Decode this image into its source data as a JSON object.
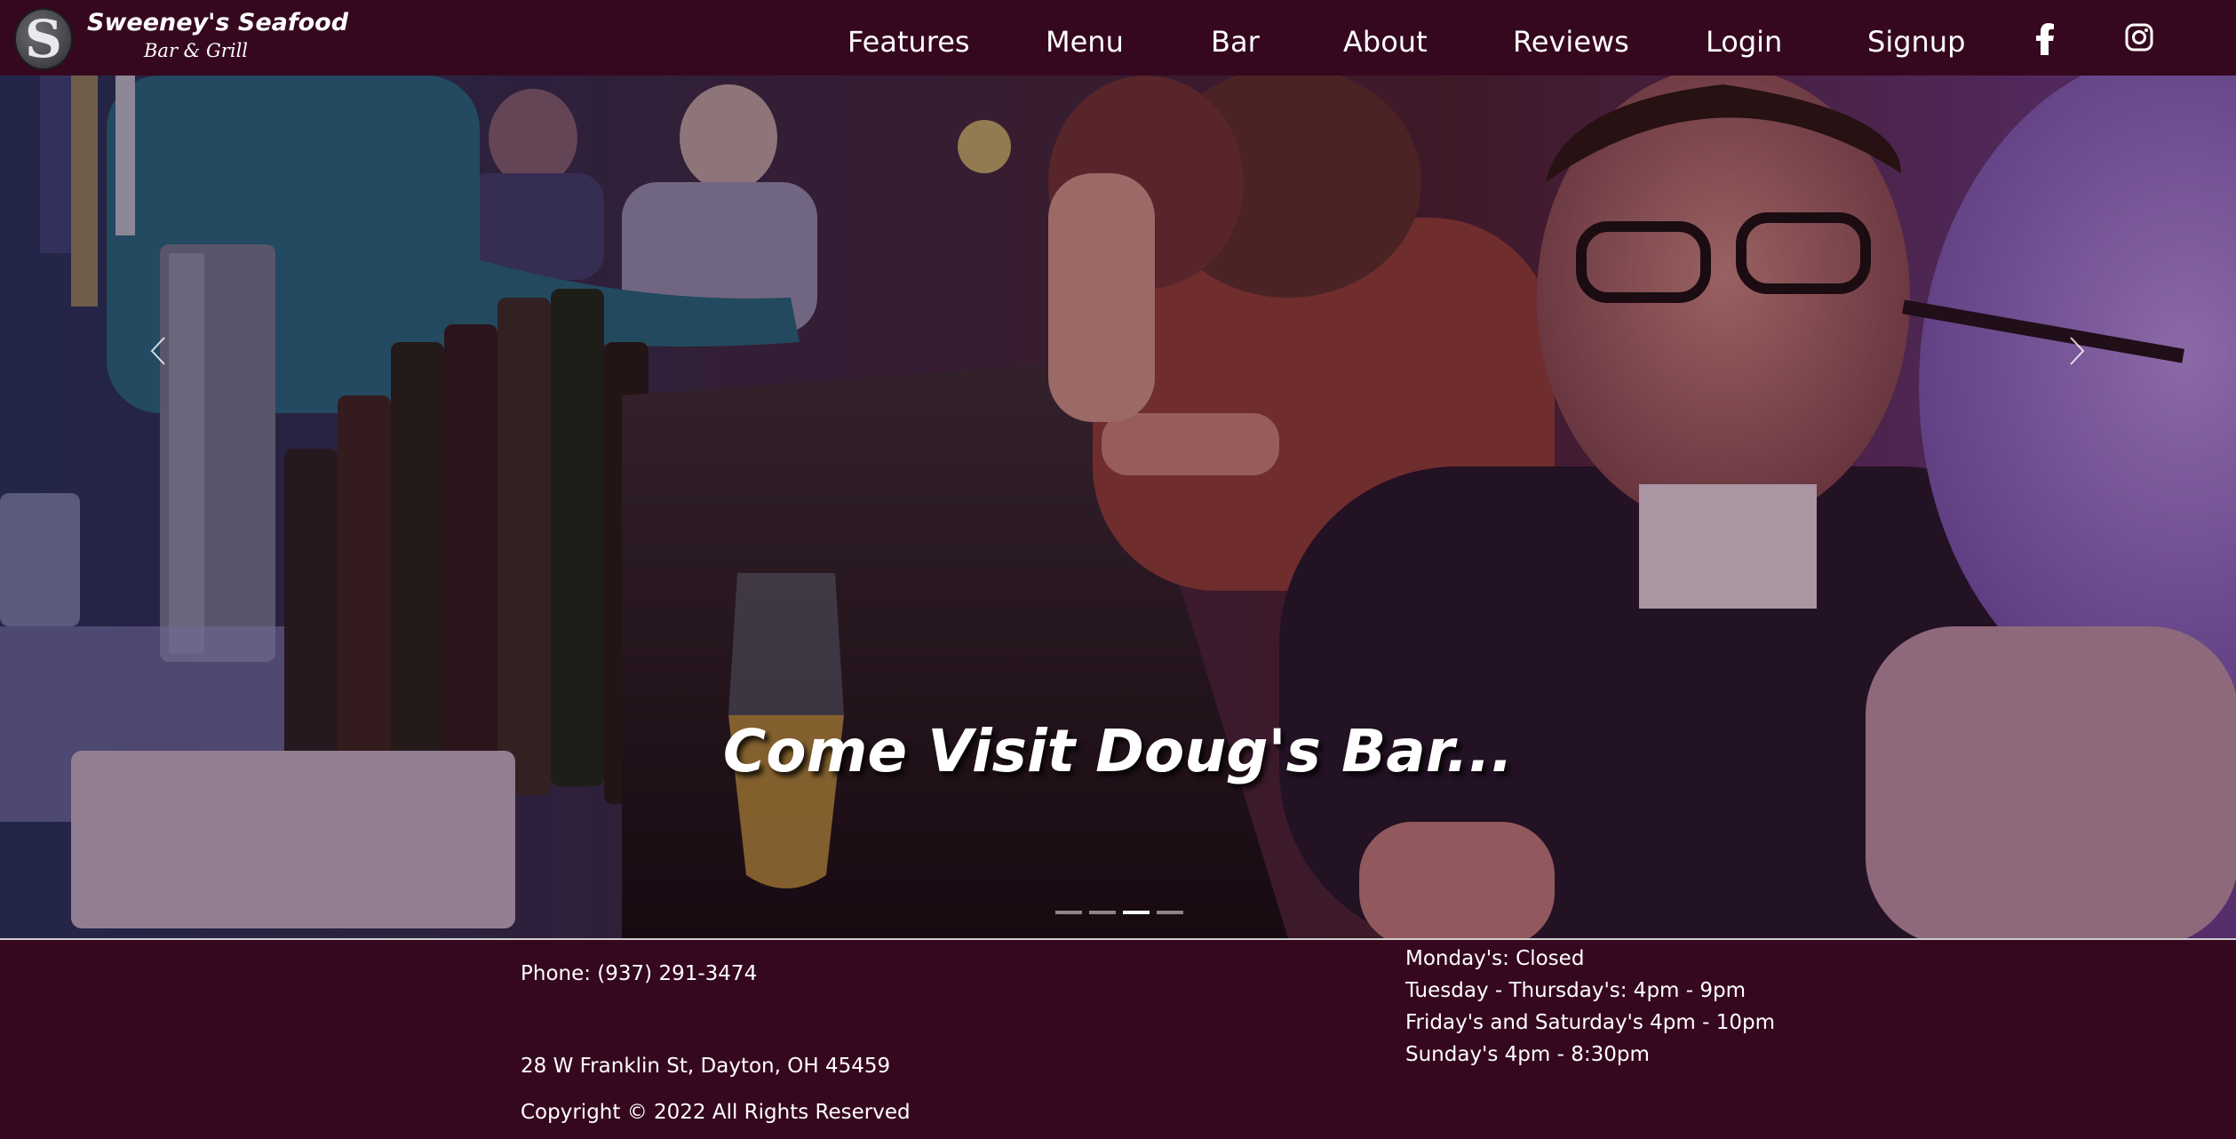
{
  "brand": {
    "logo_letter": "S",
    "name": "Sweeney's Seafood",
    "subtitle": "Bar & Grill"
  },
  "nav": {
    "links": [
      "Features",
      "Menu",
      "Bar",
      "About",
      "Reviews",
      "Login",
      "Signup"
    ],
    "icons": [
      "facebook-icon",
      "instagram-icon"
    ]
  },
  "hero": {
    "caption": "Come Visit Doug's Bar...",
    "slide_count": 4,
    "active_slide": 3
  },
  "footer": {
    "phone": "Phone: (937) 291-3474",
    "address": "28 W Franklin St, Dayton, OH 45459",
    "copyright": "Copyright © 2022 All Rights Reserved",
    "hours": [
      "Monday's: Closed",
      "Tuesday - Thursday's: 4pm - 9pm",
      "Friday's and Saturday's 4pm - 10pm",
      "Sunday's 4pm - 8:30pm"
    ]
  },
  "colors": {
    "navbar_bg": "#36081f",
    "footer_bg": "#36081f",
    "text": "#ffffff"
  }
}
